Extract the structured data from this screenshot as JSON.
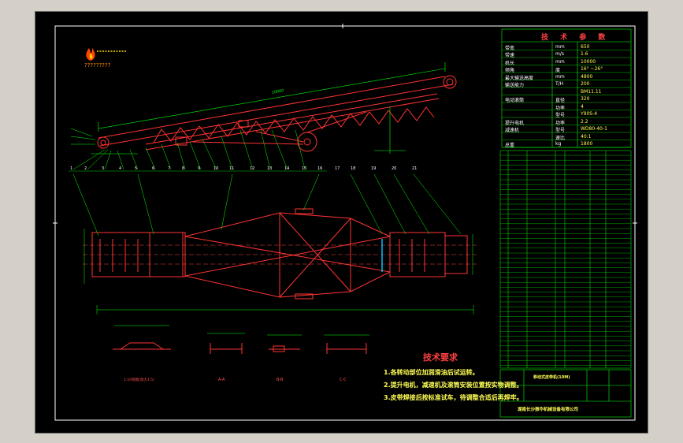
{
  "colors": {
    "background": "#d4d0c8",
    "drawing_bg": "#000000",
    "frame": "#ffffff",
    "structure": "#ff3333",
    "dimension": "#00ff00",
    "centerline": "#ff4444",
    "table_line": "#00ff00",
    "text_yellow": "#ffff55",
    "text_white": "#ffffff",
    "accent_blue": "#00bfff"
  },
  "logo": {
    "icon": "flame-logo-icon",
    "caption": "?????????"
  },
  "tech_params": {
    "title": "技 术 参 数",
    "rows": [
      {
        "name": "带宽",
        "unit": "mm",
        "value": "650"
      },
      {
        "name": "带速",
        "unit": "m/s",
        "value": "1.6"
      },
      {
        "name": "机长",
        "unit": "mm",
        "value": "10000"
      },
      {
        "name": "倾角",
        "unit": "度",
        "value": "16° ~26°"
      },
      {
        "name": "最大输送高度",
        "unit": "mm",
        "value": "4800"
      },
      {
        "name": "输送能力",
        "unit": "T/H",
        "value": "200"
      },
      {
        "name": "",
        "unit": "",
        "value": "BM11.11"
      },
      {
        "name": "电动滚筒",
        "unit": "直径",
        "value": "320"
      },
      {
        "name": "",
        "unit": "功率",
        "value": "4"
      },
      {
        "name": "",
        "unit": "型号",
        "value": "Y90S-4"
      },
      {
        "name": "提升电机",
        "unit": "功率",
        "value": "2.2"
      },
      {
        "name": "减速机",
        "unit": "型号",
        "value": "WD80-40-1"
      },
      {
        "name": "",
        "unit": "速比",
        "value": "40:1"
      },
      {
        "name": "总重",
        "unit": "kg",
        "value": "1800"
      }
    ]
  },
  "requirements": {
    "title": "技术要求",
    "items": [
      "1.各转动部位加润滑油后试运转。",
      "2.提升电机，减速机及滚筒安装位置按实物调整。",
      "3.皮带焊接后按标准试车，待调整合适后再焊牢。"
    ]
  },
  "callouts_top": [
    "1",
    "2",
    "3",
    "4",
    "5",
    "6",
    "7",
    "8",
    "9",
    "10",
    "11",
    "12",
    "13",
    "14",
    "15",
    "16",
    "17",
    "18",
    "19",
    "20",
    "21"
  ],
  "section_labels": [
    "1:10视图(放大1:5)",
    "A-A",
    "B-B",
    "C-C"
  ],
  "title_block": {
    "drawing_name": "移动式皮带机(10M)",
    "company": "湖南长沙振华机械设备有限公司"
  }
}
